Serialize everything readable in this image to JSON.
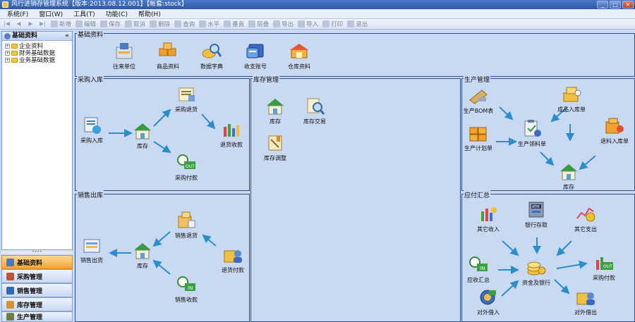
{
  "window": {
    "title": "风行进销存管理系统【版本:2013.08.12.001】【帐套:stock】",
    "buttons": {
      "minimize": "_",
      "maximize": "□",
      "close": "×"
    }
  },
  "menu": [
    "系统(F)",
    "窗口(W)",
    "工具(T)",
    "功能(C)",
    "帮助(H)"
  ],
  "toolbar": {
    "nav_icons": [
      "first-icon",
      "prev-icon",
      "next-icon",
      "last-icon"
    ],
    "buttons": [
      {
        "label": "新增",
        "icon": "add-icon"
      },
      {
        "label": "编辑",
        "icon": "edit-icon"
      },
      {
        "label": "保存",
        "icon": "save-icon"
      },
      {
        "label": "取消",
        "icon": "cancel-icon"
      },
      {
        "label": "删除",
        "icon": "delete-icon"
      },
      {
        "label": "查询",
        "icon": "query-icon"
      },
      {
        "label": "水平",
        "icon": "tile-horizontal-icon"
      },
      {
        "label": "垂直",
        "icon": "tile-vertical-icon"
      },
      {
        "label": "层叠",
        "icon": "cascade-icon"
      },
      {
        "label": "导出",
        "icon": "export-icon"
      },
      {
        "label": "导入",
        "icon": "import-icon"
      },
      {
        "label": "打印",
        "icon": "print-icon"
      },
      {
        "label": "退出",
        "icon": "exit-icon"
      }
    ]
  },
  "left_panel": {
    "title": "基础资料",
    "collapse": "«",
    "tree": [
      "企业资料",
      "财务基础数据",
      "业务基础数据"
    ],
    "nav": [
      "基础资料",
      "采购管理",
      "销售管理",
      "库存管理",
      "生产管理"
    ]
  },
  "groups": {
    "basic": {
      "title": "基础资料",
      "items": [
        "往来单位",
        "商品资料",
        "数据字典",
        "收支账号",
        "仓库资料"
      ]
    },
    "purchase": {
      "title": "采购入库",
      "items": [
        "采购入库",
        "库存",
        "采购退货",
        "退货收款",
        "采购付款"
      ]
    },
    "inventory": {
      "title": "库存管理",
      "items": [
        "库存",
        "库存交易",
        "库存调整"
      ]
    },
    "production": {
      "title": "生产管理",
      "items": [
        "生产BOM表",
        "成品入库单",
        "生产计划单",
        "生产领料单",
        "退料入库单",
        "库存"
      ]
    },
    "sales": {
      "title": "销售出库",
      "items": [
        "销售退货",
        "销售出货",
        "库存",
        "退货付款",
        "销售收款"
      ]
    },
    "finance": {
      "title": "应付汇总",
      "items": [
        "其它收入",
        "银行存取",
        "其它支出",
        "应收汇总",
        "资金及银行",
        "采购付款",
        "对外借入",
        "对外借出"
      ]
    }
  },
  "colors": {
    "accent": "#2f4f94",
    "background": "#c9d9f2",
    "arrow": "#2a8fc8",
    "active_nav": "#f2a43b"
  }
}
